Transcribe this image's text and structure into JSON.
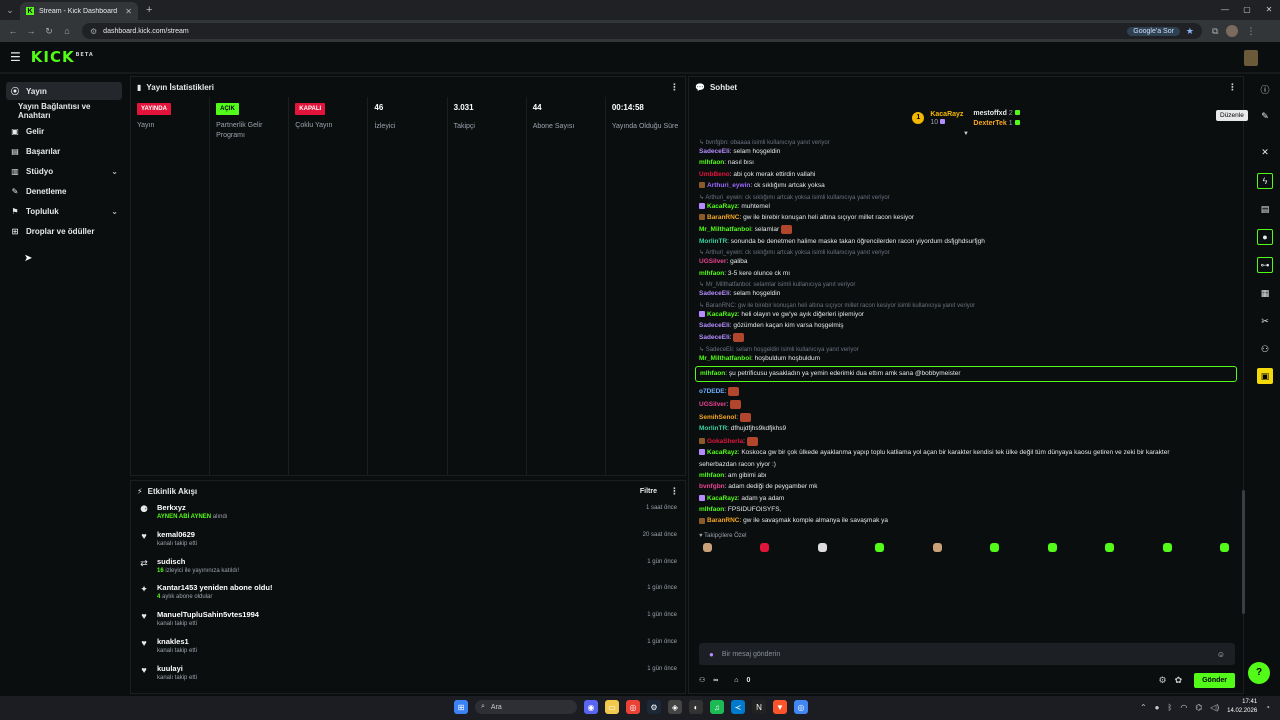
{
  "browser": {
    "tab_title": "Stream - Kick Dashboard",
    "url": "dashboard.kick.com/stream",
    "google_ask": "Google'a Sor"
  },
  "header": {
    "logo": "KICK",
    "logo_beta": "BETA"
  },
  "sidebar": {
    "items": [
      {
        "label": "Yayın",
        "icon": "broadcast-icon",
        "glyph": "((•))"
      },
      {
        "label": "Yayın Bağlantısı ve Anahtarı",
        "icon": "",
        "glyph": ""
      },
      {
        "label": "Gelir",
        "icon": "revenue-icon",
        "glyph": "▣"
      },
      {
        "label": "Başarılar",
        "icon": "achievements-icon",
        "glyph": "▤"
      },
      {
        "label": "Stüdyo",
        "icon": "studio-icon",
        "glyph": "▥"
      },
      {
        "label": "Denetleme",
        "icon": "moderation-icon",
        "glyph": "✎"
      },
      {
        "label": "Topluluk",
        "icon": "community-icon",
        "glyph": "⚑"
      },
      {
        "label": "Droplar ve ödüller",
        "icon": "drops-icon",
        "glyph": "⊞"
      }
    ]
  },
  "stats": {
    "title": "Yayın İstatistikleri",
    "cols": [
      {
        "badge": "YAYINDA",
        "label": "Yayın"
      },
      {
        "badge": "AÇIK",
        "label": "Partnerlik Gelir Programı"
      },
      {
        "badge": "KAPALI",
        "label": "Çoklu Yayın"
      },
      {
        "value": "46",
        "label": "İzleyici"
      },
      {
        "value": "3.031",
        "label": "Takipçi"
      },
      {
        "value": "44",
        "label": "Abone Sayısı"
      },
      {
        "value": "00:14:58",
        "label": "Yayında Olduğu Süre"
      }
    ]
  },
  "activity": {
    "title": "Etkinlik Akışı",
    "filter": "Filtre",
    "rows": [
      {
        "name": "Berkxyz",
        "highlight": "AYNEN ABİ AYNEN",
        "sub": " alındı",
        "time": "1 saat önce",
        "glyph": "⚈"
      },
      {
        "name": "kemal0629",
        "highlight": "",
        "sub": "kanalı takip etti",
        "time": "20 saat önce",
        "glyph": "♥"
      },
      {
        "name": "sudisch",
        "highlight": "16",
        "sub": " izleyici ile yayınınıza katıldı!",
        "time": "1 gün önce",
        "glyph": "⇄"
      },
      {
        "name": "Kantar1453 yeniden abone oldu!",
        "highlight": "4",
        "sub": " aylık abone oldular",
        "time": "1 gün önce",
        "glyph": "✦"
      },
      {
        "name": "ManuelTupluSahin5vtes1994",
        "highlight": "",
        "sub": "kanalı takip etti",
        "time": "1 gün önce",
        "glyph": "♥"
      },
      {
        "name": "knakles1",
        "highlight": "",
        "sub": "kanalı takip etti",
        "time": "1 gün önce",
        "glyph": "♥"
      },
      {
        "name": "kuulayi",
        "highlight": "",
        "sub": "kanalı takip etti",
        "time": "1 gün önce",
        "glyph": "♥"
      }
    ]
  },
  "chat": {
    "title": "Sohbet",
    "leaderboard": {
      "first": {
        "rank": "1",
        "name": "KacaRayz",
        "count": "10"
      },
      "second": {
        "name": "mestoffxd",
        "count": "2"
      },
      "third": {
        "name": "DexterTek",
        "count": "1"
      }
    },
    "messages": [
      {
        "reply": "↳ bvnfgbn: obaaaa isimli kullanıcıya yanıt veriyor"
      },
      {
        "user": "SadeceEli",
        "color": "#b48cff",
        "text": "selam hoşgeldin"
      },
      {
        "user": "mlhfaon",
        "color": "#53fc18",
        "text": "nasıl bısı"
      },
      {
        "user": "UmbBeno",
        "color": "#e3143c",
        "text": "abi çok merak ettirdin vallahi"
      },
      {
        "user": "Arthuri_eywin",
        "color": "#9b6bff",
        "text": "ck sıklığımı artcak yoksa",
        "badge": "#8b5a2b"
      },
      {
        "reply": "↳ Arthuri_eywin: ck sıklığımı artcak yoksa isimli kullanıcıya yanıt veriyor"
      },
      {
        "user": "KacaRayz",
        "color": "#53fc18",
        "text": "muhtemel",
        "badge": "#b48cff"
      },
      {
        "user": "BaranRNC",
        "color": "#f5a623",
        "text": "gw ile birebir konuşan heli altına sıçıyor millet racon kesiyor",
        "badge": "#8b5a2b"
      },
      {
        "user": "Mr_Milthatfanboi",
        "color": "#53fc18",
        "text": "selamlar",
        "emote": true
      },
      {
        "user": "MorlinTR",
        "color": "#3ad0a0",
        "text": "sonunda be denetmen halime maske takan öğrencilerden racon yiyordum dsfjghdsurfjgh"
      },
      {
        "reply": "↳ Arthuri_eywin: ck sıklığımı artcak yoksa isimli kullanıcıya yanıt veriyor"
      },
      {
        "user": "UGSilver",
        "color": "#e84393",
        "text": "galiba"
      },
      {
        "user": "mlhfaon",
        "color": "#53fc18",
        "text": "3-5 kere olunce ck mı"
      },
      {
        "reply": "↳ Mr_Milthatfanboi: selamlar isimli kullanıcıya yanıt veriyor"
      },
      {
        "user": "SadeceEli",
        "color": "#b48cff",
        "text": "selam hoşgeldin"
      },
      {
        "reply": "↳ BaranRNC: gw ile birebir konuşan heli altına sıçıyor millet racon kesiyor isimli kullanıcıya yanıt veriyor"
      },
      {
        "user": "KacaRayz",
        "color": "#53fc18",
        "text": "heli olayın ve gw'ye ayık diğerleri iplemiyor",
        "badge": "#b48cff"
      },
      {
        "user": "SadeceEli",
        "color": "#b48cff",
        "text": "gözümden kaçan kim varsa hoşgelmiş"
      },
      {
        "user": "SadeceEli",
        "color": "#b48cff",
        "text": "",
        "emote": true
      },
      {
        "reply": "↳ SadeceEli: selam hoşgeldin isimli kullanıcıya yanıt veriyor"
      },
      {
        "user": "Mr_Milthatfanboi",
        "color": "#53fc18",
        "text": "hoşbuldum hoşbuldum"
      },
      {
        "user": "mlhfaon",
        "color": "#53fc18",
        "text": "şu petrificusu yasakladın ya yemin ederimki dua ettım amk sana @bobbymeister",
        "highlight": true
      },
      {
        "user": "o7DEDE",
        "color": "#6ab0ff",
        "text": "",
        "emote": true
      },
      {
        "user": "UGSilver",
        "color": "#e84393",
        "text": "",
        "emote": true
      },
      {
        "user": "SemihSenol",
        "color": "#f5a623",
        "text": "",
        "emote": true
      },
      {
        "user": "MorlinTR",
        "color": "#3ad0a0",
        "text": "dfhujdfjhs9kdfjkhs9"
      },
      {
        "user": "GokaSherla",
        "color": "#e3143c",
        "text": "",
        "emote": true,
        "badge": "#8b5a2b"
      },
      {
        "user": "KacaRayz",
        "color": "#53fc18",
        "text": "Koskoca gw bir çok ülkede ayaklanma yapıp toplu katliama yol açan bir karakter kendisi tek ülke değil tüm dünyaya kaosu getiren ve zeki bir karakter",
        "badge": "#b48cff"
      },
      {
        "cont": "seherbazdan racon yiyor :)"
      },
      {
        "user": "mlhfaon",
        "color": "#53fc18",
        "text": "am gibimi abı"
      },
      {
        "user": "bvnfgbn",
        "color": "#e84393",
        "text": "adam dediği de peygamber mk"
      },
      {
        "user": "KacaRayz",
        "color": "#53fc18",
        "text": "adam ya adam",
        "badge": "#b48cff"
      },
      {
        "user": "mlhfaon",
        "color": "#53fc18",
        "text": "FPSIDUFOISYFS,"
      },
      {
        "user": "BaranRNC",
        "color": "#f5a623",
        "text": "gw ile savaşmak komple almanya ile savaşmak ya",
        "badge": "#8b5a2b"
      }
    ],
    "followers_label": "♥ Takipçilere Özel",
    "input_placeholder": "Bir mesaj gönderin",
    "points": "0",
    "infinity": "∞",
    "send": "Gönder",
    "emotes": [
      "#c9a27a",
      "#e3143c",
      "#dddddd",
      "#53fc18",
      "#c9a27a",
      "#53fc18",
      "#53fc18",
      "#53fc18",
      "#53fc18",
      "#53fc18"
    ]
  },
  "rail": {
    "tooltip": "Düzenle"
  },
  "taskbar": {
    "search": "Ara",
    "time": "17:41",
    "date": "14.02.2026"
  },
  "colors": {
    "accent": "#53fc18",
    "live": "#e3143c",
    "bg": "#0b0e0f"
  }
}
